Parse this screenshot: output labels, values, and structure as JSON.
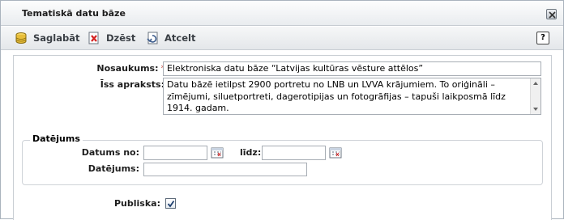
{
  "dialog": {
    "title": "Tematiskā datu bāze",
    "close_icon": "close-icon"
  },
  "toolbar": {
    "save_label": "Saglabāt",
    "delete_label": "Dzēst",
    "cancel_label": "Atcelt",
    "help_label": "?",
    "icons": [
      "save-icon",
      "delete-icon",
      "cancel-icon",
      "help-icon"
    ]
  },
  "form": {
    "name_label": "Nosaukums:",
    "required_mark": "*",
    "name_value": "Elektroniska datu bāze “Latvijas kultūras vēsture attēlos”",
    "description_label": "Īss apraksts:",
    "description_value": "Datu bāzē ietilpst 2900 portretu no LNB un LVVA krājumiem. To oriģināli – zīmējumi, siluetportreti, dagerotipijas un fotogrāfijas – tapuši laikposmā līdz 1914. gadam.",
    "dating_legend": "Datējums",
    "date_from_label": "Datums no:",
    "date_from_value": "",
    "date_to_label": "līdz:",
    "date_to_value": "",
    "dating_label": "Datējums:",
    "dating_value": "",
    "public_label": "Publiska:",
    "public_checked": true
  },
  "colors": {
    "required": "#c0392b",
    "toolbar_text": "#3a3f45",
    "border": "#a7adb4"
  }
}
